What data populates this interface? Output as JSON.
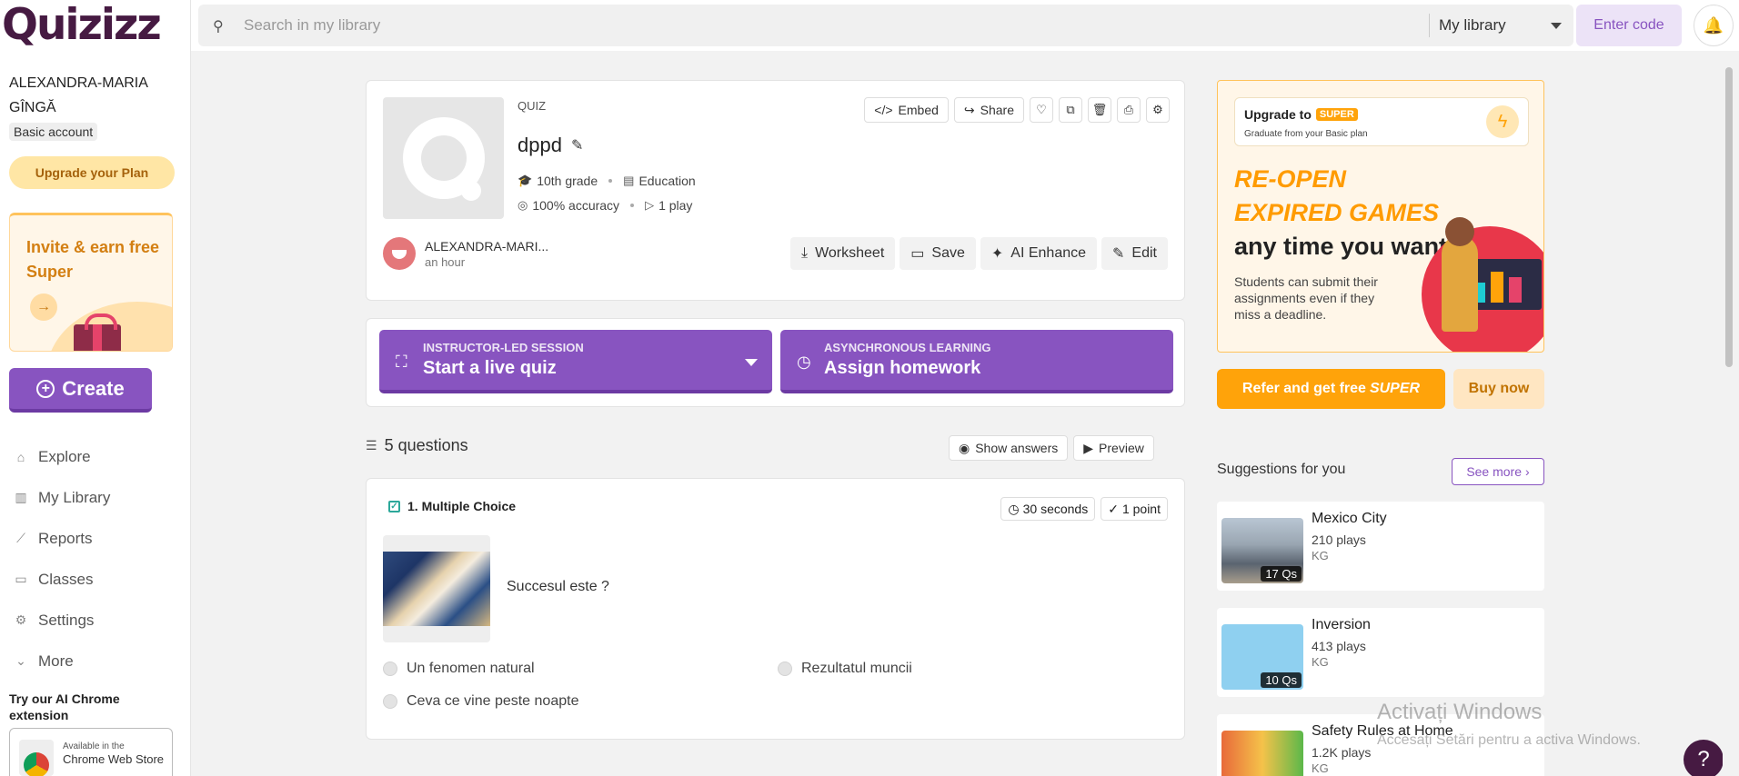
{
  "app": {
    "logo": "Quizizz"
  },
  "sidebar": {
    "user_name": "ALEXANDRA-MARIA GÎNGĂ",
    "account_type": "Basic account",
    "upgrade_label": "Upgrade your Plan",
    "invite": {
      "text": "Invite & earn free Super",
      "arrow_icon": "arrow-right-icon"
    },
    "create_label": "Create",
    "nav": [
      {
        "label": "Explore",
        "icon": "explore-icon"
      },
      {
        "label": "My Library",
        "icon": "library-icon"
      },
      {
        "label": "Reports",
        "icon": "reports-icon"
      },
      {
        "label": "Classes",
        "icon": "classes-icon"
      },
      {
        "label": "Settings",
        "icon": "settings-icon"
      },
      {
        "label": "More",
        "icon": "chevron-down-icon"
      }
    ],
    "chrome_ext_text": "Try our AI Chrome extension",
    "webstore": {
      "line1": "Available in the",
      "line2": "Chrome Web Store"
    }
  },
  "header": {
    "search_placeholder": "Search in my library",
    "library_select": "My library",
    "enter_code": "Enter code"
  },
  "quiz": {
    "type": "QUIZ",
    "title": "dppd",
    "grade": "10th grade",
    "subject": "Education",
    "accuracy": "100% accuracy",
    "plays": "1 play",
    "actions_top": {
      "embed": "Embed",
      "share": "Share"
    },
    "author": {
      "name": "ALEXANDRA-MARI...",
      "time": "an hour"
    },
    "actions_bottom": {
      "worksheet": "Worksheet",
      "save": "Save",
      "ai_enhance": "AI Enhance",
      "edit": "Edit"
    }
  },
  "sessions": {
    "live": {
      "label": "INSTRUCTOR-LED SESSION",
      "value": "Start a live quiz"
    },
    "homework": {
      "label": "ASYNCHRONOUS LEARNING",
      "value": "Assign homework"
    }
  },
  "questions": {
    "count_label": "5 questions",
    "show_answers": "Show answers",
    "preview": "Preview",
    "items": [
      {
        "header": "1. Multiple Choice",
        "time": "30 seconds",
        "points": "1 point",
        "text": "Succesul este ?",
        "answers": [
          "Un fenomen natural",
          "Rezultatul muncii",
          "Ceva ce vine peste noapte"
        ]
      }
    ]
  },
  "promo": {
    "upgrade_to": "Upgrade to",
    "super_badge": "SUPER",
    "subline": "Graduate from your Basic plan",
    "headline_orange": "RE-OPEN EXPIRED GAMES",
    "headline_rest": "any time you want",
    "body": "Students can submit their assignments even if they miss a deadline.",
    "refer_label": "Refer and get free",
    "refer_super": "SUPER",
    "buy_label": "Buy now"
  },
  "suggestions": {
    "title": "Suggestions for you",
    "see_more": "See more",
    "items": [
      {
        "name": "Mexico City",
        "plays": "210 plays",
        "grade": "KG",
        "qs": "17 Qs"
      },
      {
        "name": "Inversion",
        "plays": "413 plays",
        "grade": "KG",
        "qs": "10 Qs"
      },
      {
        "name": "Safety Rules at Home",
        "plays": "1.2K plays",
        "grade": "KG",
        "qs": ""
      }
    ]
  },
  "watermark": {
    "line1": "Activați Windows",
    "line2": "Accesați Setări pentru a activa Windows."
  },
  "colors": {
    "primary": "#8854c0",
    "brand": "#461a42",
    "accent": "#ffa30a"
  }
}
